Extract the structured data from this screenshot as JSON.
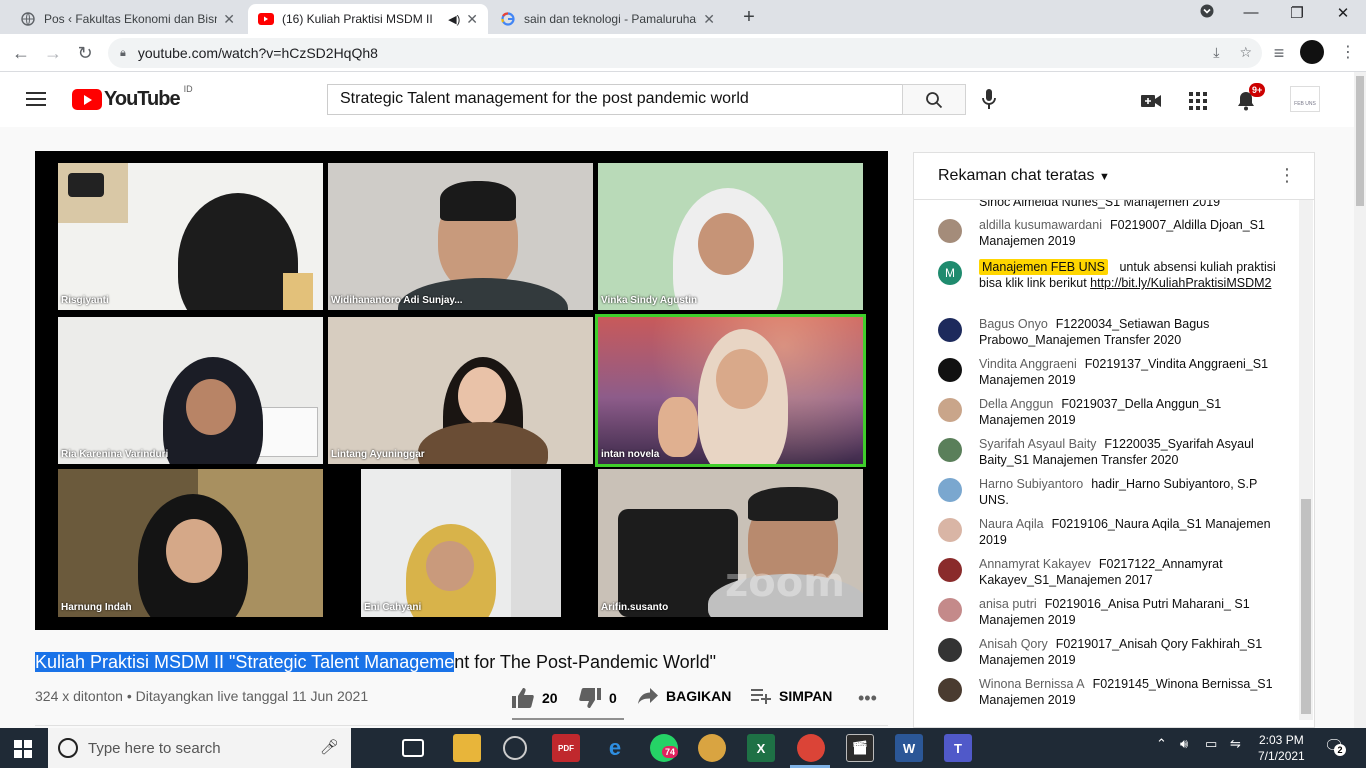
{
  "browser": {
    "tabs": [
      {
        "title": "Pos ‹ Fakultas Ekonomi dan Bisnis",
        "active": false
      },
      {
        "title": "(16) Kuliah Praktisi MSDM II",
        "active": true
      },
      {
        "title": "sain dan teknologi - Pamaluruhan",
        "active": false
      }
    ],
    "url": "youtube.com/watch?v=hCzSD2HqQh8"
  },
  "youtube": {
    "logo_text": "YouTube",
    "country": "ID",
    "search_value": "Strategic Talent management for the post pandemic world",
    "notification_count": "9+",
    "channel_logo_text": "FEB UNS"
  },
  "video": {
    "participants": [
      {
        "name": "Risgiyanti"
      },
      {
        "name": "Widihanantoro Adi Sunjay..."
      },
      {
        "name": "Vinka Sindy Agustin"
      },
      {
        "name": "Ria Karenina Varinduri"
      },
      {
        "name": "Lintang Ayuninggar"
      },
      {
        "name": "intan novela"
      },
      {
        "name": "Harnung Indah"
      },
      {
        "name": "Eni Cahyani"
      },
      {
        "name": "Arifin.susanto"
      }
    ],
    "watermark": "zoom",
    "title_selected": "Kuliah Praktisi MSDM II \"Strategic Talent Manageme",
    "title_rest": "nt for The Post-Pandemic World\"",
    "meta": "324 x ditonton • Ditayangkan live tanggal 11 Jun 2021",
    "likes": "20",
    "dislikes": "0",
    "share_label": "BAGIKAN",
    "save_label": "SIMPAN"
  },
  "chat": {
    "header": "Rekaman chat teratas",
    "cut_top": "Sinoc Almeida Nunes_S1 Manajemen 2019",
    "messages": [
      {
        "author": "aldilla kusumawardani",
        "text": "F0219007_Aldilla Djoan_S1 Manajemen 2019"
      },
      {
        "author": "Manajemen FEB UNS",
        "text": "untuk absensi kuliah praktisi bisa klik link berikut ",
        "link": "http://bit.ly/KuliahPraktisiMSDM2"
      },
      {
        "author": "Bagus Onyo",
        "text": "F1220034_Setiawan Bagus Prabowo_Manajemen Transfer 2020"
      },
      {
        "author": "Vindita Anggraeni",
        "text": "F0219137_Vindita Anggraeni_S1 Manajemen 2019"
      },
      {
        "author": "Della Anggun",
        "text": "F0219037_Della Anggun_S1 Manajemen 2019"
      },
      {
        "author": "Syarifah Asyaul Baity",
        "text": "F1220035_Syarifah Asyaul Baity_S1 Manajemen Transfer 2020"
      },
      {
        "author": "Harno Subiyantoro",
        "text": "hadir_Harno Subiyantoro, S.P UNS."
      },
      {
        "author": "Naura Aqila",
        "text": "F0219106_Naura Aqila_S1 Manajemen 2019"
      },
      {
        "author": "Annamyrat Kakayev",
        "text": "F0217122_Annamyrat Kakayev_S1_Manajemen 2017"
      },
      {
        "author": "anisa putri",
        "text": "F0219016_Anisa Putri Maharani_ S1 Manajemen 2019"
      },
      {
        "author": "Anisah Qory",
        "text": "F0219017_Anisah Qory Fakhirah_S1 Manajemen 2019"
      },
      {
        "author": "Winona Bernissa A",
        "text": "F0219145_Winona Bernissa_S1 Manajemen 2019"
      }
    ],
    "owner_avatar_letter": "M"
  },
  "taskbar": {
    "search_placeholder": "Type here to search",
    "time": "2:03 PM",
    "date": "7/1/2021",
    "whatsapp_badge": "74",
    "notifications": "2"
  },
  "colors": {
    "youtube_red": "#ff0000",
    "owner_highlight": "#ffd600",
    "active_speaker": "#3fce2b",
    "selection": "#1a73e8"
  }
}
